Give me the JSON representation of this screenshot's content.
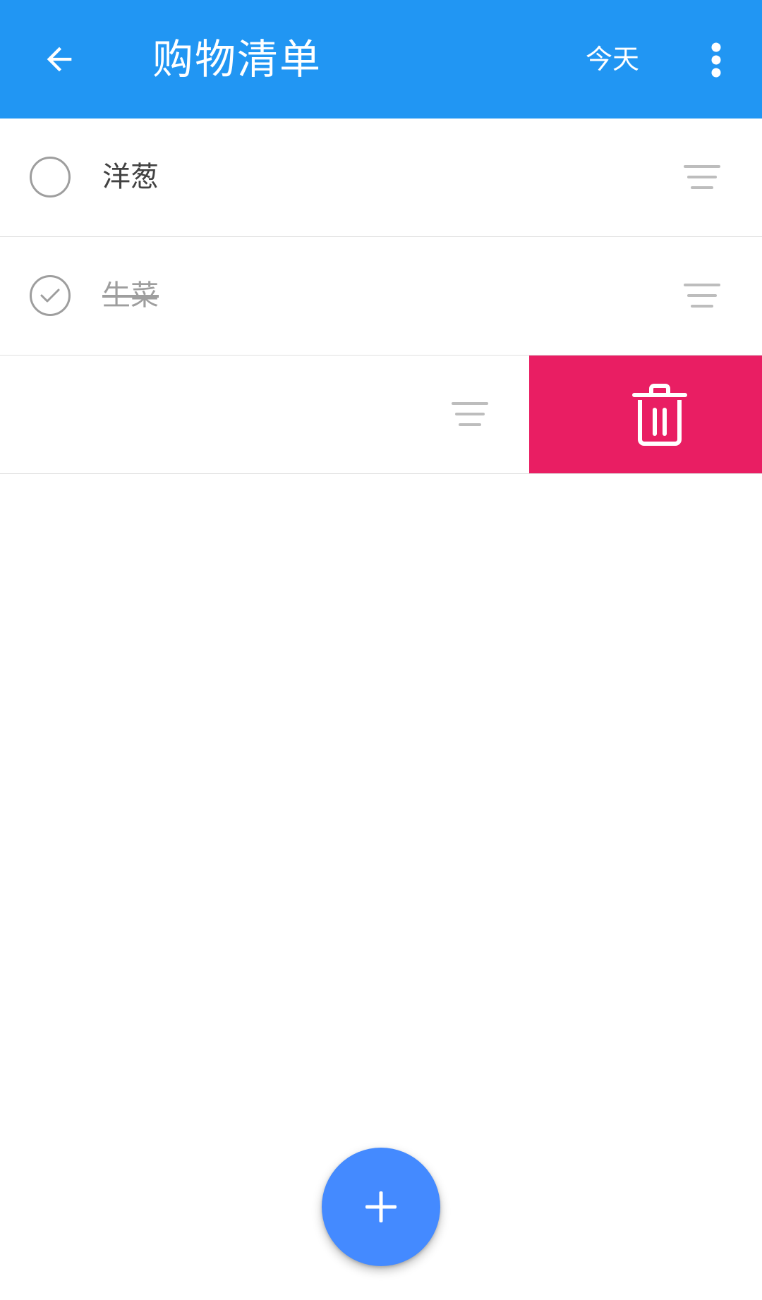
{
  "appbar": {
    "title": "购物清单",
    "today_label": "今天",
    "background": "#2196F3"
  },
  "icons": {
    "back": "arrow-back-icon",
    "more": "more-vert-icon",
    "drag": "drag-handle-icon",
    "delete": "trash-icon",
    "add": "plus-icon"
  },
  "items": [
    {
      "label": "洋葱",
      "checked": false
    },
    {
      "label": "生菜",
      "checked": true
    },
    {
      "label": "",
      "checked": false,
      "swiped": true
    }
  ],
  "colors": {
    "delete_background": "#E91E63",
    "fab_background": "#448AFF",
    "checked_text": "#9e9e9e",
    "text": "#424242"
  }
}
